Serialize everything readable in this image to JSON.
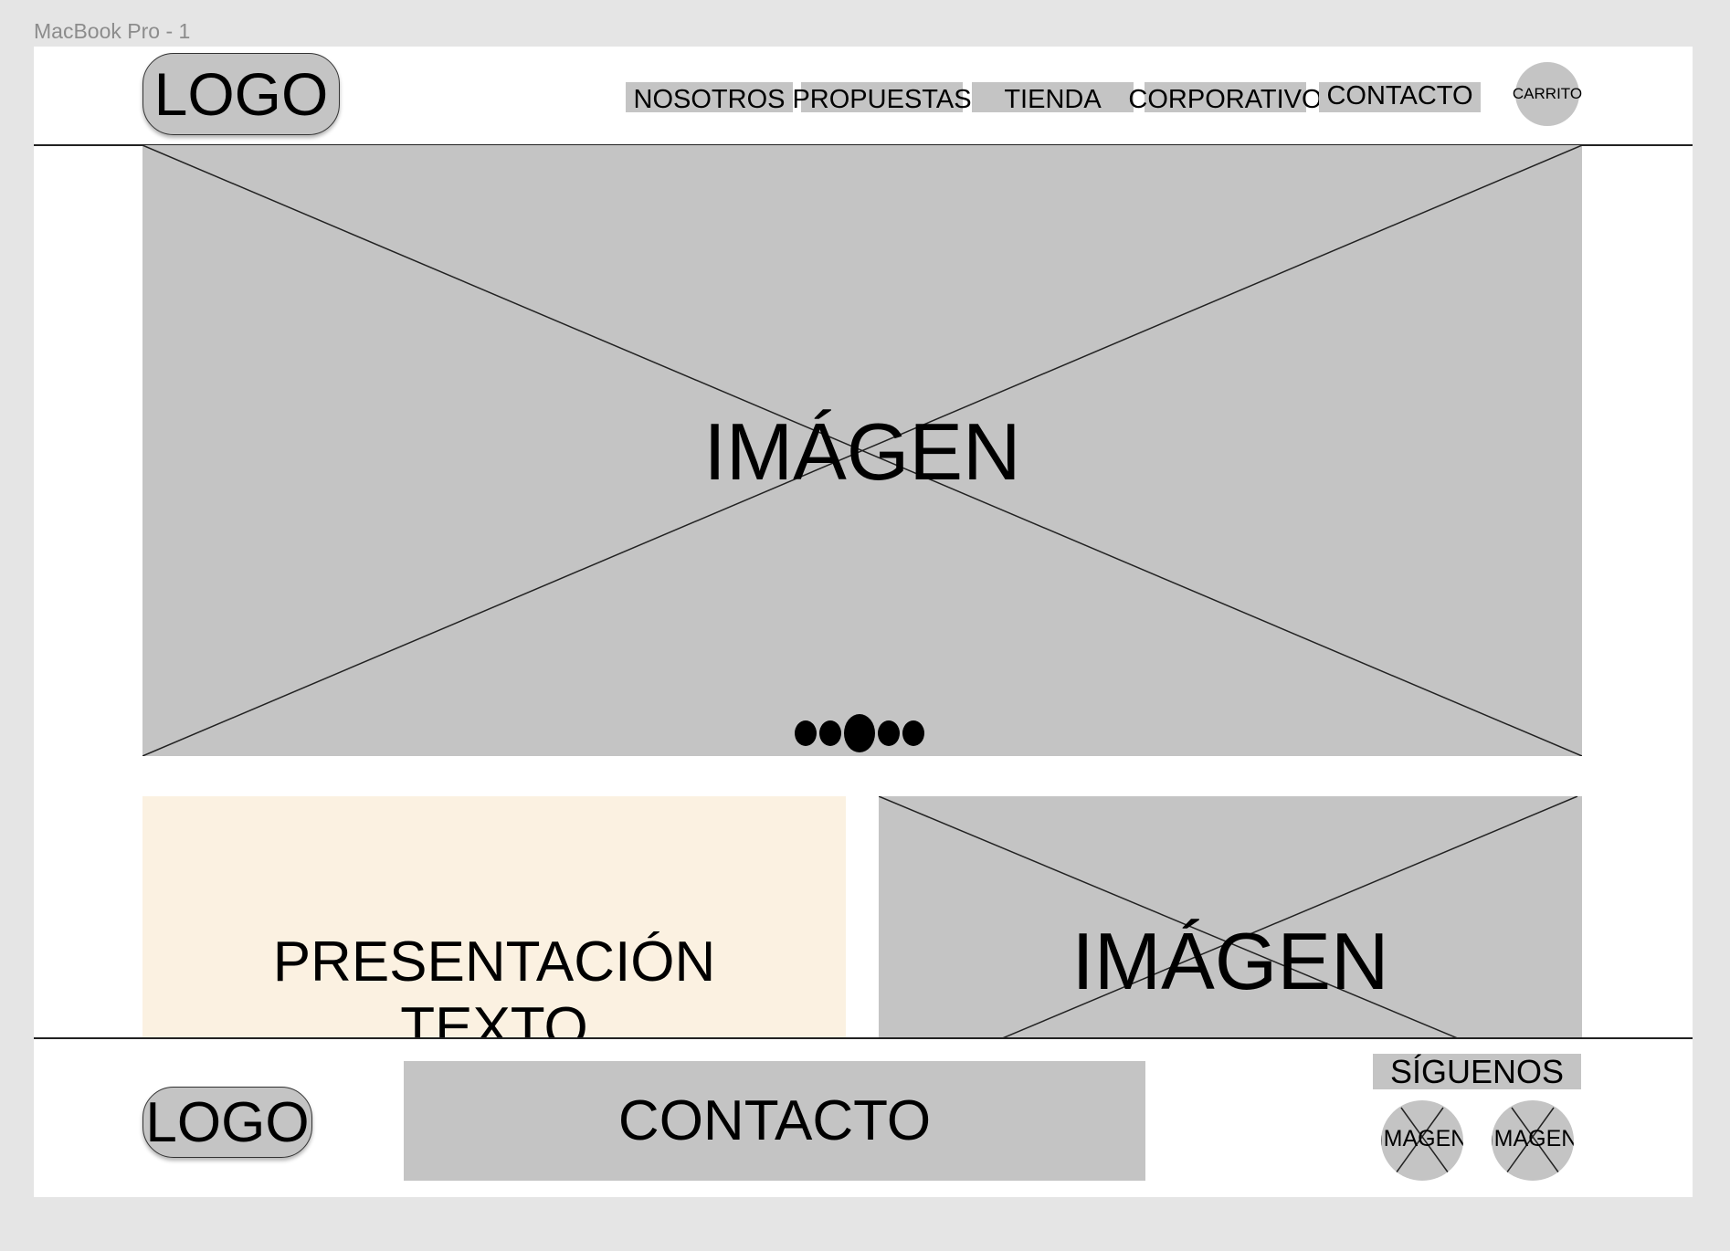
{
  "frame": {
    "label": "MacBook Pro - 1"
  },
  "header": {
    "logo": "LOGO",
    "nav": [
      {
        "label": "NOSOTROS"
      },
      {
        "label": "PROPUESTAS"
      },
      {
        "label": "TIENDA"
      },
      {
        "label": "CORPORATIVO"
      },
      {
        "label": "CONTACTO"
      }
    ],
    "cart": "CARRITO"
  },
  "hero": {
    "label": "IMÁGEN",
    "carousel": {
      "total": 5,
      "active_index": 2
    }
  },
  "content": {
    "presentation": {
      "line1": "PRESENTACIÓN",
      "line2": "TEXTO"
    },
    "image_label": "IMÁGEN"
  },
  "footer": {
    "logo": "LOGO",
    "contact": "CONTACTO",
    "follow": "SÍGUENOS",
    "social": [
      {
        "label": "IMAGEN"
      },
      {
        "label": "IMAGEN"
      }
    ]
  },
  "colors": {
    "placeholder": "#c4c4c4",
    "cream": "#fbf1e1",
    "canvas": "#e5e5e5"
  }
}
